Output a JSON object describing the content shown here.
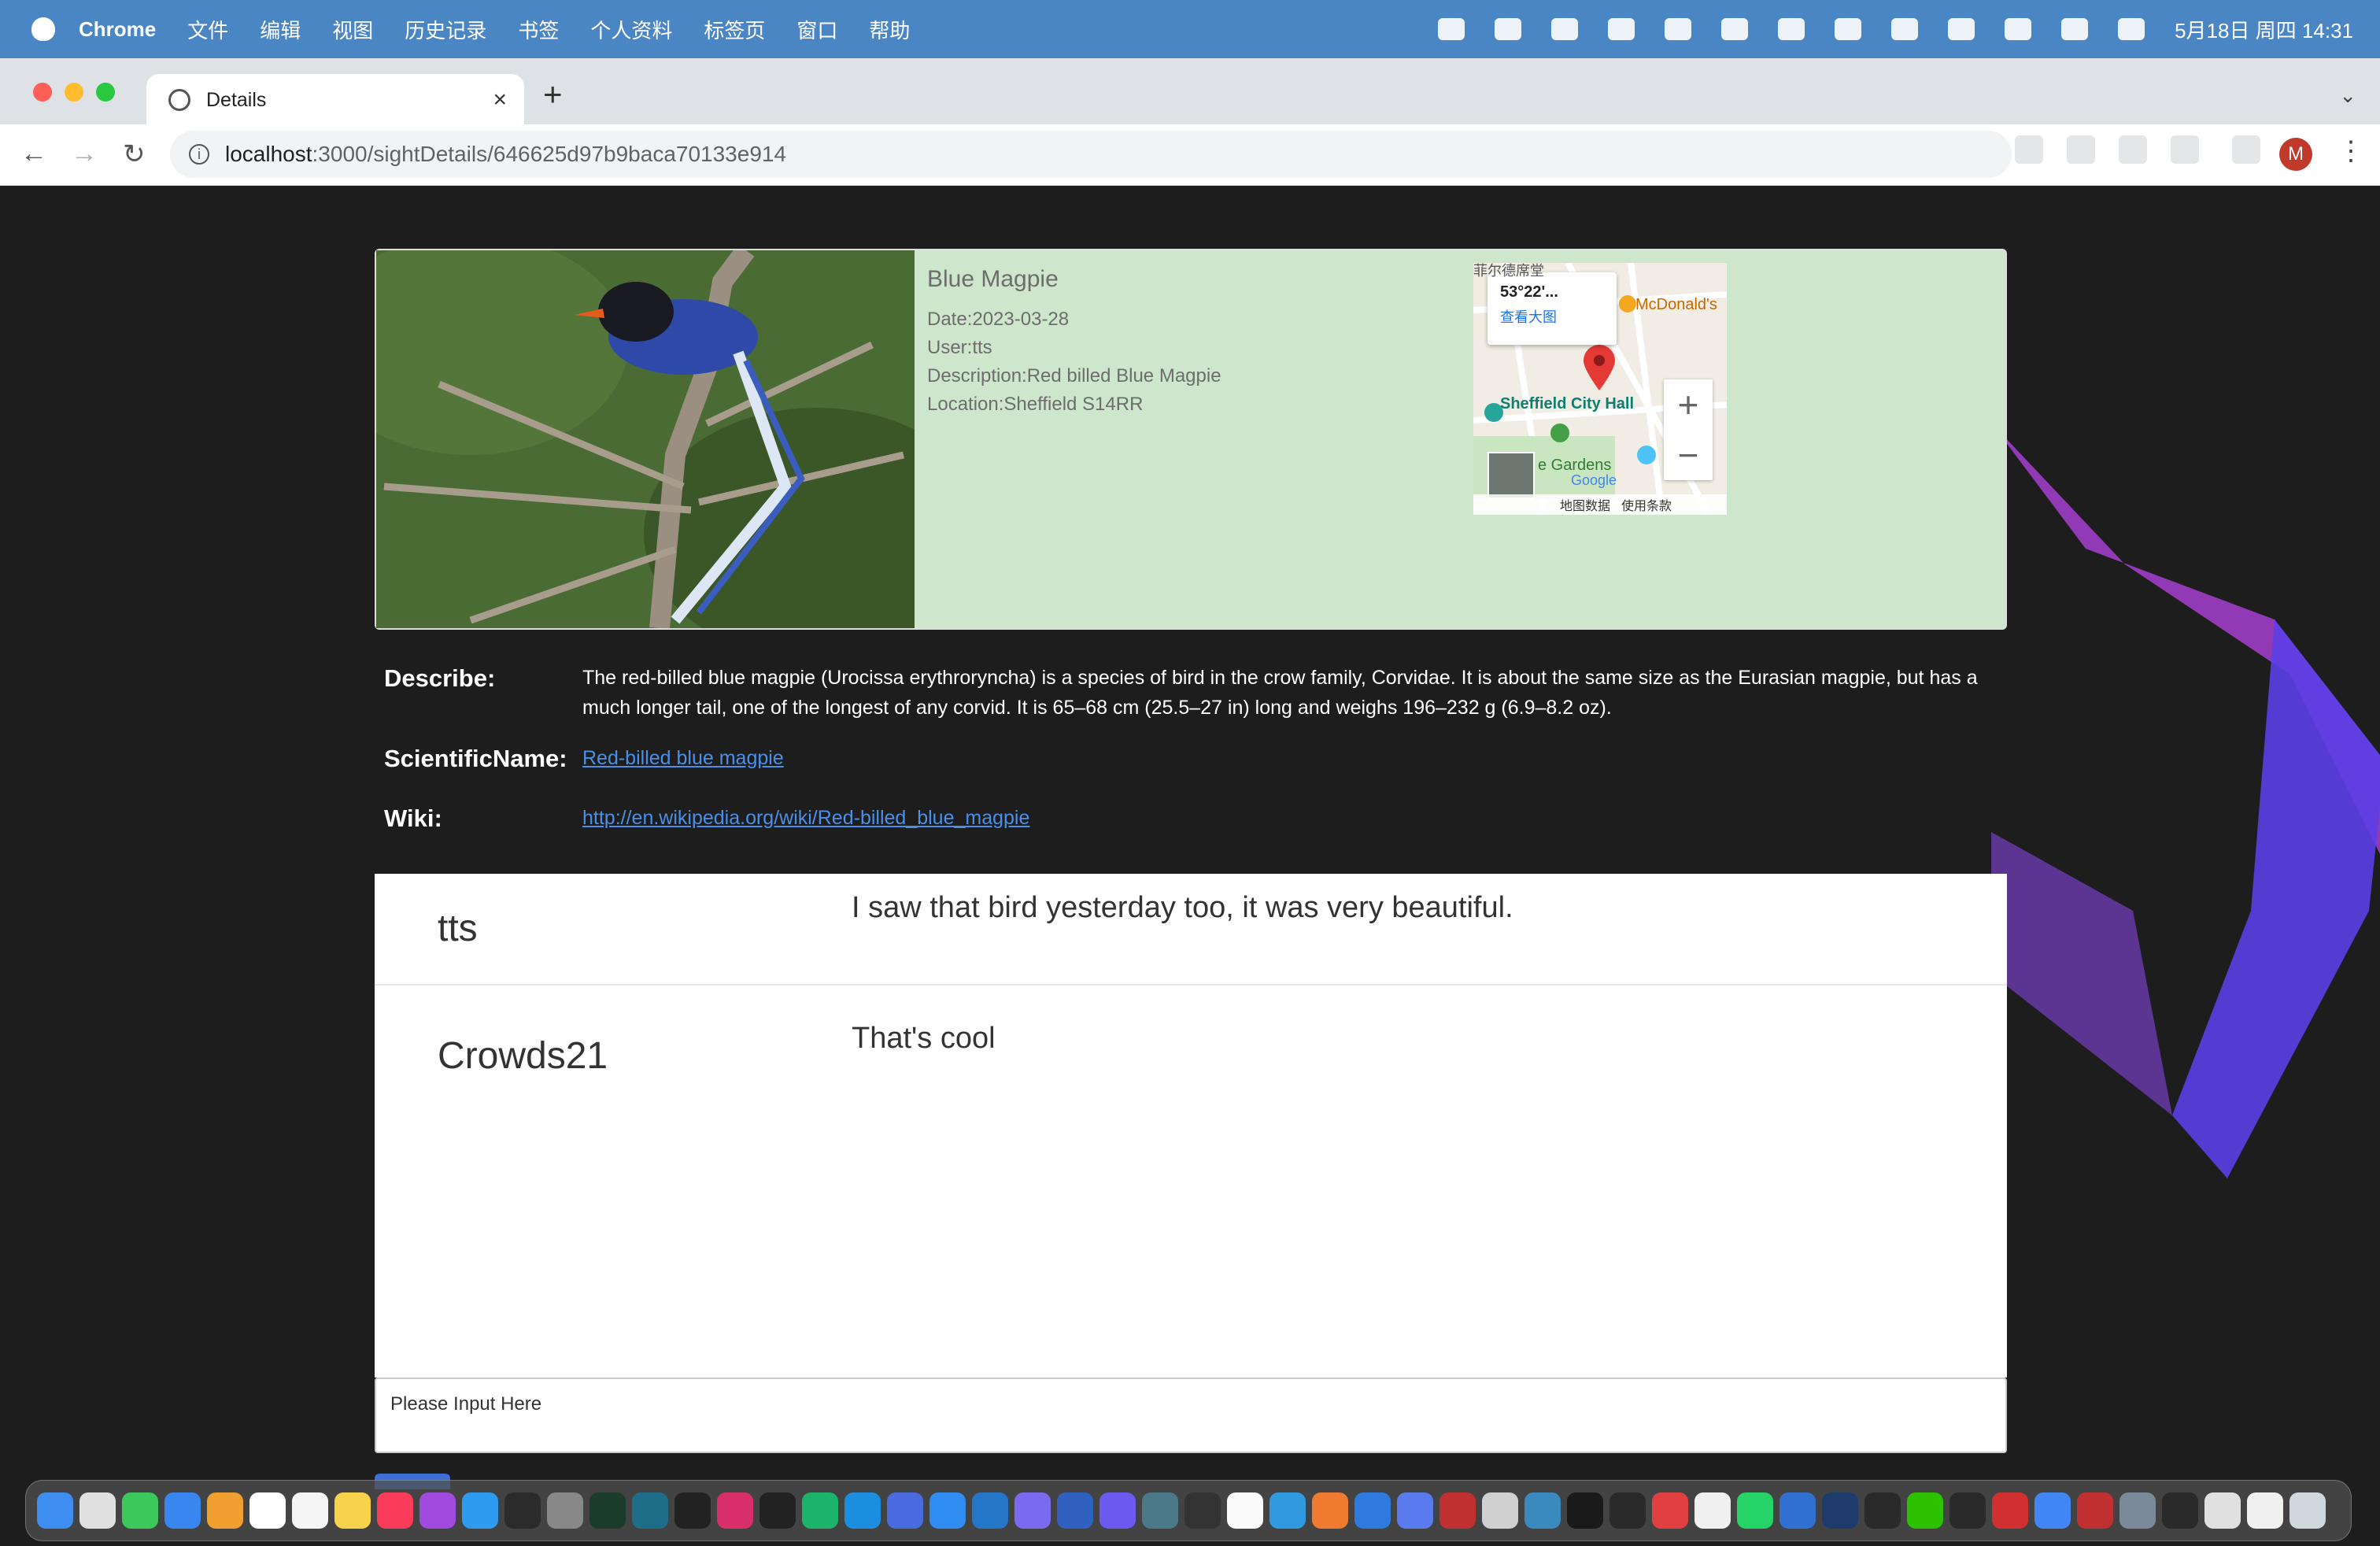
{
  "menubar": {
    "app_name": "Chrome",
    "items": [
      "文件",
      "编辑",
      "视图",
      "历史记录",
      "书签",
      "个人资料",
      "标签页",
      "窗口",
      "帮助"
    ],
    "clock": "5月18日 周四  14:31"
  },
  "browser": {
    "tab_title": "Details",
    "url_host": "localhost",
    "url_path": ":3000/sightDetails/646625d97b9baca70133e914",
    "avatar_letter": "M"
  },
  "sighting": {
    "title": "Blue Magpie",
    "date": "Date:2023-03-28",
    "user": "User:tts",
    "description": "Description:Red billed Blue Magpie",
    "location": "Location:Sheffield S14RR"
  },
  "map": {
    "popup_coord": "53°22'...",
    "popup_link": "查看大图",
    "label_mcdonalds": "McDonald's",
    "label_city_hall": "Sheffield City Hall",
    "label_gardens": "e Gardens",
    "label_top": "菲尔德席堂",
    "label_google": "Google",
    "footer_data": "地图数据",
    "footer_terms": "使用条款"
  },
  "details": {
    "describe_label": "Describe:",
    "describe_text": "The red-billed blue magpie (Urocissa erythroryncha) is a species of bird in the crow family, Corvidae. It is about the same size as the Eurasian magpie, but has a much longer tail, one of the longest of any corvid. It is 65–68 cm (25.5–27 in) long and weighs 196–232 g (6.9–8.2 oz).",
    "scientific_label": "ScientificName:",
    "scientific_link": "Red-billed blue magpie",
    "wiki_label": "Wiki:",
    "wiki_link": "http://en.wikipedia.org/wiki/Red-billed_blue_magpie"
  },
  "comments": [
    {
      "user": "tts",
      "text": "I saw that bird yesterday too, it was very beautiful."
    },
    {
      "user": "Crowds21",
      "text": "That's cool"
    }
  ],
  "comment_input": {
    "placeholder": "Please Input Here"
  },
  "colors": {
    "menubar": "#4b86c4",
    "card": "#cde6cc",
    "page_bg": "#1d1d1d",
    "link": "#4a8fe8",
    "ribbon": "#8b3fe0"
  },
  "dock_icons": [
    "finder-icon",
    "launchpad-icon",
    "messages-icon",
    "mail-icon",
    "photos-icon",
    "calendar-icon",
    "reminders-icon",
    "notes-icon",
    "music-icon",
    "podcasts-icon",
    "appstore-icon",
    "terminal-icon",
    "system-settings-icon",
    "terminal-alt-icon",
    "app-icon",
    "arc-icon",
    "intellij-icon",
    "datagrip-icon",
    "pycharm-icon",
    "webstorm-icon",
    "app-icon",
    "safari-icon",
    "vscode-icon",
    "app-icon",
    "app-icon",
    "app-icon",
    "app-icon",
    "app-icon",
    "typora-icon",
    "edge-icon",
    "app-icon",
    "app-icon",
    "app-icon",
    "app-icon",
    "app-icon",
    "app-icon",
    "app-icon",
    "chatgpt-icon",
    "app-icon",
    "app-icon",
    "whatsapp-icon",
    "app-icon",
    "app-icon",
    "app-icon",
    "wechat-icon",
    "app-icon",
    "wps-icon",
    "chrome-icon",
    "app-icon",
    "preview-icon",
    "app-icon",
    "app-icon",
    "app-icon",
    "trash-icon"
  ]
}
